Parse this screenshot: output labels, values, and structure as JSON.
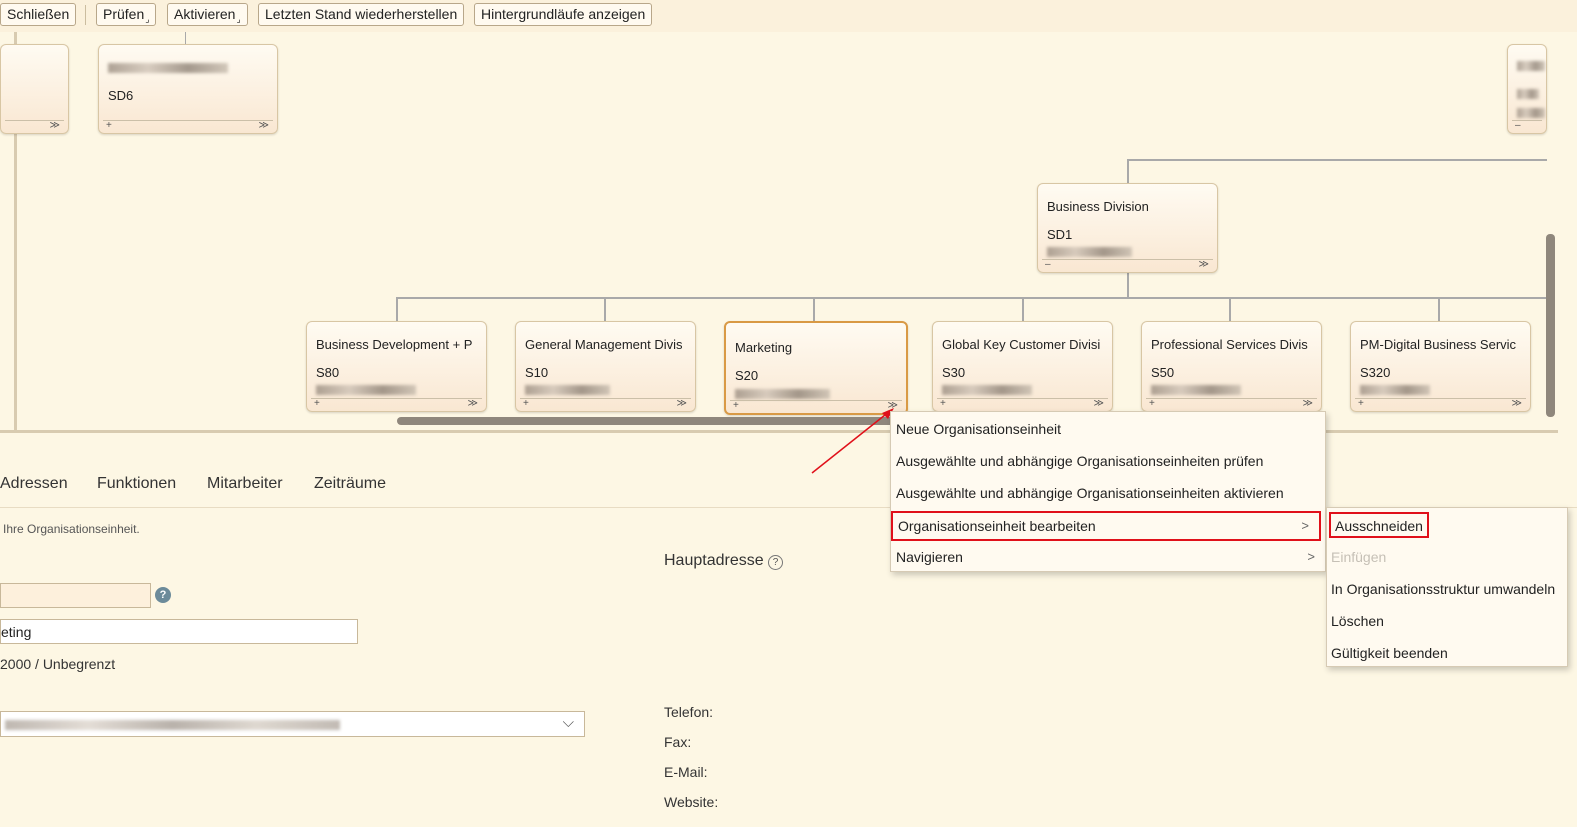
{
  "toolbar": {
    "close_label": "Schließen",
    "check_label": "Prüfen",
    "activate_label": "Aktivieren",
    "restore_label": "Letzten Stand wiederherstellen",
    "background_label": "Hintergrundläufe anzeigen"
  },
  "org_nodes": {
    "top_mid": {
      "code": "SD6"
    },
    "division": {
      "title": "Business Division",
      "code": "SD1"
    },
    "children": [
      {
        "title": "Business Development + P",
        "code": "S80"
      },
      {
        "title": "General Management Divis",
        "code": "S10"
      },
      {
        "title": "Marketing",
        "code": "S20"
      },
      {
        "title": "Global Key Customer Divisi",
        "code": "S30"
      },
      {
        "title": "Professional Services Divis",
        "code": "S50"
      },
      {
        "title": "PM-Digital Business Servic",
        "code": "S320"
      }
    ],
    "plus_symbol": "+",
    "minus_symbol": "–",
    "expand_symbol": "≫"
  },
  "tabs": [
    "Adressen",
    "Funktionen",
    "Mitarbeiter",
    "Zeiträume"
  ],
  "form": {
    "hint": "Ihre Organisationseinheit.",
    "name_value": "eting",
    "validity": "2000 / Unbegrenzt",
    "main_address_label": "Hauptadresse",
    "help_glyph": "?",
    "phone_label": "Telefon:",
    "fax_label": "Fax:",
    "email_label": "E-Mail:",
    "website_label": "Website:"
  },
  "context_menu": {
    "items": [
      {
        "label": "Neue Organisationseinheit"
      },
      {
        "label": "Ausgewählte und abhängige Organisationseinheiten prüfen"
      },
      {
        "label": "Ausgewählte und abhängige Organisationseinheiten aktivieren"
      },
      {
        "label": "Organisationseinheit bearbeiten"
      },
      {
        "label": "Navigieren"
      }
    ],
    "submenu_arrow": ">"
  },
  "submenu": {
    "items": [
      {
        "label": "Ausschneiden"
      },
      {
        "label": "Einfügen"
      },
      {
        "label": "In Organisationsstruktur umwandeln"
      },
      {
        "label": "Löschen"
      },
      {
        "label": "Gültigkeit beenden"
      }
    ]
  },
  "colors": {
    "highlight_border": "#e0101a",
    "selected_node_border": "#d99a45",
    "background": "#fdf7e4"
  }
}
